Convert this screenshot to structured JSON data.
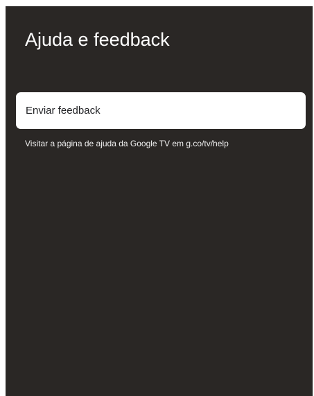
{
  "settings_panel": {
    "title": "Ajuda e feedback",
    "items": [
      {
        "label": "Enviar feedback"
      }
    ],
    "help_text": "Visitar a página de ajuda da Google TV em g.co/tv/help"
  }
}
